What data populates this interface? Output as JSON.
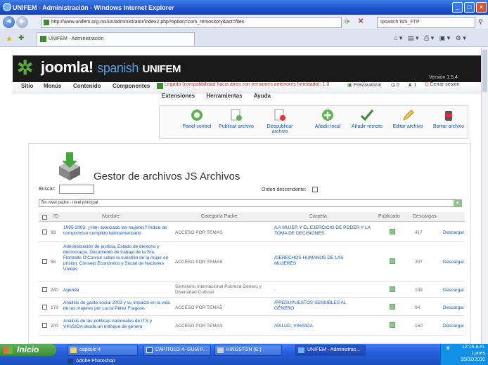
{
  "browser": {
    "title": "UNIFEM - Administración - Windows Internet Explorer",
    "url": "http://www.unifem.org.mx/un/administrator/index2.php?option=com_remository&act=files",
    "search_value": "Ipswitch WS_FTP",
    "tab_label": "UNIFEM - Administración"
  },
  "header": {
    "logo_main": "joomla!",
    "logo_spanish": "spanish",
    "logo_site": "UNIFEM",
    "version": "Versión 1.5.4"
  },
  "menu": {
    "items": [
      "Sitio",
      "Menús",
      "Contenido",
      "Componentes"
    ],
    "subitems": [
      "Extensiones",
      "Herramientas",
      "Ayuda"
    ],
    "legacy_notice": "Legado (compatibilidad hacia atrás con versiones anteriores heredada): 1.0",
    "preview": "Previsualizar",
    "counter_1": "0",
    "counter_2": "1",
    "logout": "Cerrar sesión"
  },
  "toolbar": {
    "panel": "Panel control",
    "publish": "Publicar archivo",
    "unpublish": "Despublicar archivo",
    "add_local": "Añadir local",
    "add_remote": "Añadir remoto",
    "edit": "Editar archivo",
    "delete": "Borrar archivo"
  },
  "content": {
    "title": "Gestor de archivos JS Archivos",
    "search_label": "Buscar:",
    "order_label": "Orden descendente:",
    "select_value": "Sin nivel padre - nivel principal"
  },
  "table": {
    "headers": [
      "ID",
      "Nombre",
      "Categoría Padre",
      "Carpeta",
      "Publicado",
      "Descargas"
    ],
    "rows": [
      {
        "id": "93",
        "name": "1995-2003: ¿Han avanzado las mujeres? Índice de compromiso cumplido latinoamericano",
        "category": "ACCESO POR TEMAS",
        "folder": "/LA MUJER Y EL EJERCICIO DE PODER Y LA TOMA DE DECISIONES",
        "downloads": "417",
        "action": "Descargar"
      },
      {
        "id": "58",
        "name": "Administración de justicia, Estado de derecho y democracia. Documento de trabajo de la Sra. Florizelle O'Connor sobre la cuestión de la mujer en prisión. Consejo Económico y Social de Naciones Unidas",
        "category": "ACCESO POR TEMAS",
        "folder": "/DERECHOS HUMANOS DE LAS MUJERES",
        "downloads": "207",
        "action": "Descargar"
      },
      {
        "id": "240",
        "name": "Agenda",
        "category": "Seminario Internacional Pobreza Genero y Diversidad Cultural",
        "folder": "-",
        "downloads": "109",
        "action": "Descargar"
      },
      {
        "id": "173",
        "name": "Análisis de gasto social 2003 y su impacto en la vida de las mujeres por Lucía Pérez Fragoso",
        "category": "ACCESO POR TEMAS",
        "folder": "/PRESUPUESTOS SENSIBLES AL GÉNERO",
        "downloads": "94",
        "action": "Descargar"
      },
      {
        "id": "200",
        "name": "Análisis de las políticas nacionales de ITS y VIH/SIDA desde un enfoque de género",
        "category": "ACCESO POR TEMAS",
        "folder": "/SALUD, VIH/SIDA",
        "downloads": "160",
        "action": "Descargar"
      }
    ]
  },
  "taskbar": {
    "start": "Inicio",
    "tasks": [
      "capitulo 4",
      "CAPITULO 4- GUIA P...",
      "KINGSTON (E:)",
      "UNIFEM - Administrac..."
    ],
    "task_row2": "Adobe Photoshop",
    "time": "12:15 a.m.",
    "day": "Lunes",
    "date": "15/02/2010"
  }
}
